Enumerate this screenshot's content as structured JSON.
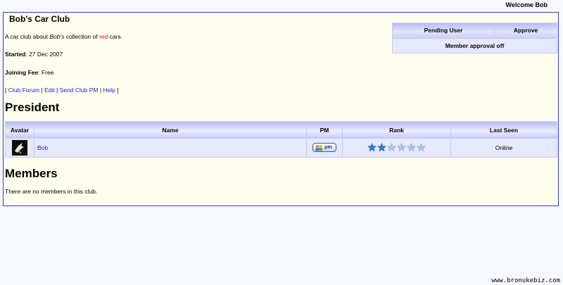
{
  "header": {
    "welcome": "Welcome Bob"
  },
  "club": {
    "title": "Bob's Car Club",
    "description": {
      "part1": "A car club about ",
      "owner": "Bob's",
      "part2": " collection of ",
      "highlight": "red",
      "part3": " cars."
    },
    "started_label": "Started",
    "started_value": ": 27 Dec 2007",
    "fee_label": "Joining Fee",
    "fee_value": ": Free",
    "links": {
      "open": "[ ",
      "forum": "Club Forum",
      "edit": "Edit",
      "pm": "Send Club PM",
      "help": "Help",
      "sep": " | ",
      "close": " ]"
    }
  },
  "pending": {
    "pending_user": "Pending User",
    "approve": "Approve",
    "approval_status": "Member approval off"
  },
  "president": {
    "heading": "President",
    "columns": {
      "avatar": "Avatar",
      "name": "Name",
      "pm": "PM",
      "rank": "Rank",
      "last_seen": "Last Seen"
    },
    "row": {
      "name": "Bob",
      "pm_label": "pm",
      "rank_stars": 2,
      "rank_max": 6,
      "last_seen": "Online"
    }
  },
  "members": {
    "heading": "Members",
    "empty_text": "There are no members in this club."
  },
  "footer": {
    "url": "www.bronukebiz.com"
  },
  "colors": {
    "border": "#3a3ab8",
    "link": "#2222cc",
    "highlight": "#e00000",
    "star_filled": "#2f7fd6",
    "star_empty": "#a9c6e6"
  },
  "icons": {
    "star": "star-icon",
    "pm": "pm-icon",
    "avatar": "dove-avatar"
  }
}
